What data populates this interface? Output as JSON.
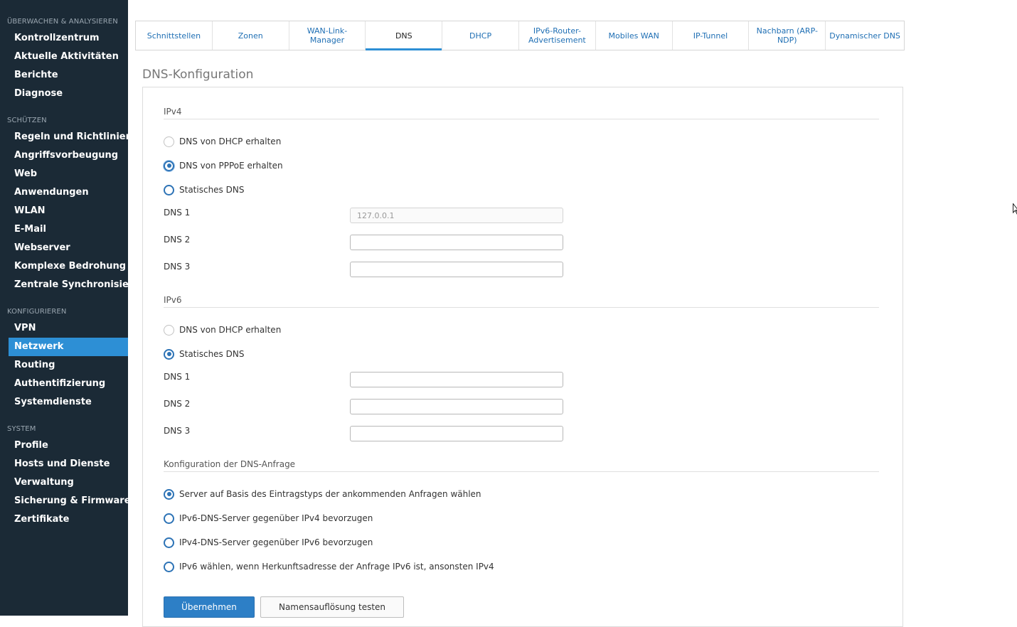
{
  "sidebar": {
    "sections": [
      {
        "title": "ÜBERWACHEN & ANALYSIEREN",
        "items": [
          "Kontrollzentrum",
          "Aktuelle Aktivitäten",
          "Berichte",
          "Diagnose"
        ]
      },
      {
        "title": "SCHÜTZEN",
        "items": [
          "Regeln und Richtlinien",
          "Angriffsvorbeugung",
          "Web",
          "Anwendungen",
          "WLAN",
          "E-Mail",
          "Webserver",
          "Komplexe Bedrohung",
          "Zentrale Synchronisierung"
        ]
      },
      {
        "title": "KONFIGURIEREN",
        "items": [
          "VPN",
          "Netzwerk",
          "Routing",
          "Authentifizierung",
          "Systemdienste"
        ]
      },
      {
        "title": "SYSTEM",
        "items": [
          "Profile",
          "Hosts und Dienste",
          "Verwaltung",
          "Sicherung & Firmware",
          "Zertifikate"
        ]
      }
    ],
    "active_item": "Netzwerk",
    "colors": {
      "background": "#1b2a36",
      "active": "#2d8fd5"
    }
  },
  "tabs": [
    "Schnittstellen",
    "Zonen",
    "WAN-Link-Manager",
    "DNS",
    "DHCP",
    "IPv6-Router-Advertisement",
    "Mobiles WAN",
    "IP-Tunnel",
    "Nachbarn (ARP-NDP)",
    "Dynamischer DNS"
  ],
  "active_tab": "DNS",
  "page_title": "DNS-Konfiguration",
  "ipv4": {
    "title": "IPv4",
    "options": [
      {
        "label": "DNS von DHCP erhalten",
        "checked": false,
        "disabled": true
      },
      {
        "label": "DNS von PPPoE erhalten",
        "checked": true,
        "disabled": false
      },
      {
        "label": "Statisches DNS",
        "checked": false,
        "disabled": false
      }
    ],
    "fields": [
      {
        "label": "DNS 1",
        "value": "127.0.0.1",
        "disabled": true
      },
      {
        "label": "DNS 2",
        "value": "",
        "disabled": false
      },
      {
        "label": "DNS 3",
        "value": "",
        "disabled": false
      }
    ]
  },
  "ipv6": {
    "title": "IPv6",
    "options": [
      {
        "label": "DNS von DHCP erhalten",
        "checked": false,
        "disabled": true
      },
      {
        "label": "Statisches DNS",
        "checked": true,
        "disabled": false
      }
    ],
    "fields": [
      {
        "label": "DNS 1",
        "value": ""
      },
      {
        "label": "DNS 2",
        "value": ""
      },
      {
        "label": "DNS 3",
        "value": ""
      }
    ]
  },
  "query": {
    "title": "Konfiguration der DNS-Anfrage",
    "options": [
      {
        "label": "Server auf Basis des Eintragstyps der ankommenden Anfragen wählen",
        "checked": true
      },
      {
        "label": "IPv6-DNS-Server gegenüber IPv4 bevorzugen",
        "checked": false
      },
      {
        "label": "IPv4-DNS-Server gegenüber IPv6 bevorzugen",
        "checked": false
      },
      {
        "label": "IPv6 wählen, wenn Herkunftsadresse der Anfrage IPv6 ist, ansonsten IPv4",
        "checked": false
      }
    ]
  },
  "buttons": {
    "apply": "Übernehmen",
    "test": "Namensauflösung testen"
  },
  "icons": {
    "cursor": "mouse-cursor-icon"
  }
}
